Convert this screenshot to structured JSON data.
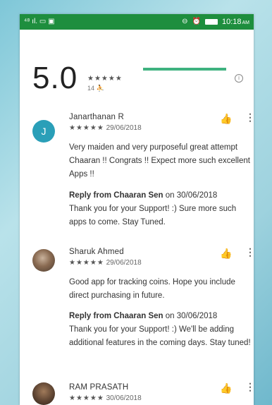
{
  "status_bar": {
    "left_icons": "⁴⁸ ıl. ▭ ▣",
    "time": "10:18",
    "ampm": "AM"
  },
  "rating_summary": {
    "score": "5.0",
    "stars": "★★★★★",
    "count": "14",
    "bar_fill_fraction": 1.0
  },
  "reviews": [
    {
      "avatar_letter": "J",
      "name": "Janarthanan R",
      "stars": "★★★★★",
      "date": "29/06/2018",
      "text": "Very maiden and very purposeful great attempt Chaaran !! Congrats !! Expect more such excellent Apps !!",
      "reply_from": "Reply from Chaaran Sen",
      "reply_date": "on 30/06/2018",
      "reply_text": "Thank you for your Support! :) Sure more such apps to come. Stay Tuned."
    },
    {
      "name": "Sharuk Ahmed",
      "stars": "★★★★★",
      "date": "29/06/2018",
      "text": "Good app for tracking coins. Hope you include direct purchasing in future.",
      "reply_from": "Reply from Chaaran Sen",
      "reply_date": "on 30/06/2018",
      "reply_text": "Thank you for your Support! :) We'll be adding additional features in the coming days. Stay tuned!"
    },
    {
      "name": "RAM PRASATH",
      "stars": "★★★★★",
      "date": "30/06/2018"
    }
  ]
}
